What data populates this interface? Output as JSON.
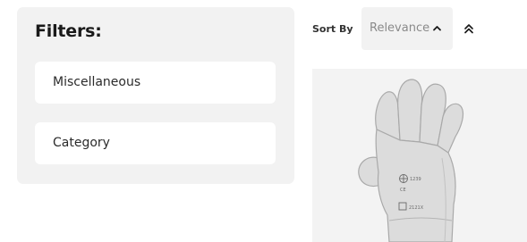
{
  "filters": {
    "title": "Filters:",
    "items": [
      {
        "label": "Miscellaneous"
      },
      {
        "label": "Category"
      }
    ]
  },
  "sort": {
    "label": "Sort By",
    "selected": "Relevance",
    "caret_icon": "chevron-up-icon",
    "toggle_icon": "double-chevron-up-icon"
  },
  "product": {
    "image_icon": "work-glove-image",
    "image_text": "1239 / CE / 2121X"
  },
  "colors": {
    "panel_bg": "#f2f2f2",
    "card_bg": "#ffffff",
    "text_dark": "#1a1a1a",
    "text_muted": "#8a8a8a",
    "image_bg": "#f3f3f3"
  }
}
